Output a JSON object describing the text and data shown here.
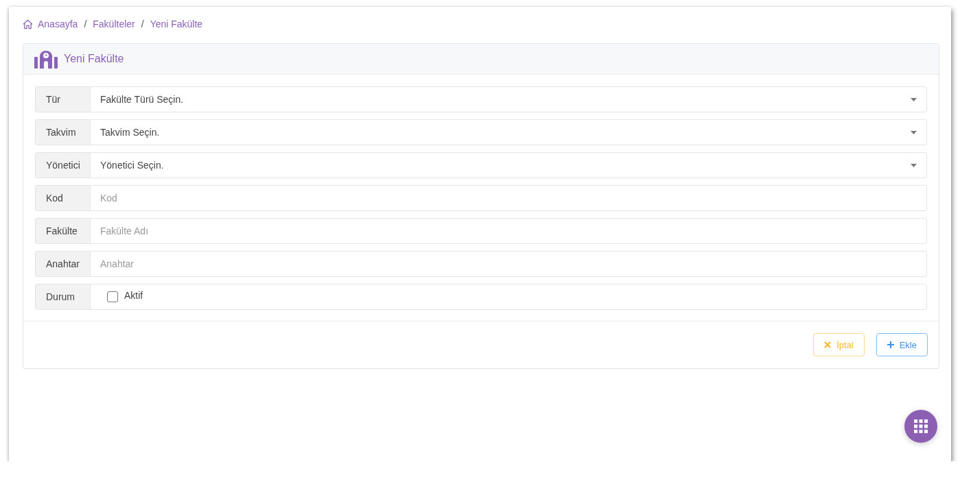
{
  "breadcrumb": {
    "items": [
      {
        "label": "Anasayfa"
      },
      {
        "label": "Fakülteler"
      },
      {
        "label": "Yeni Fakülte"
      }
    ],
    "separators": [
      "/",
      "/"
    ]
  },
  "card": {
    "title": "Yeni Fakülte"
  },
  "form_rows": [
    {
      "kind": "select",
      "label": "Tür",
      "value": "Fakülte Türü Seçin."
    },
    {
      "kind": "select",
      "label": "Takvim",
      "value": "Takvim Seçin."
    },
    {
      "kind": "select",
      "label": "Yönetici",
      "value": "Yönetici Seçin."
    },
    {
      "kind": "text",
      "label": "Kod",
      "placeholder": "Kod"
    },
    {
      "kind": "text",
      "label": "Fakülte",
      "placeholder": "Fakülte Adı"
    },
    {
      "kind": "text",
      "label": "Anahtar",
      "placeholder": "Anahtar"
    },
    {
      "kind": "checkbox",
      "label": "Durum",
      "option": "Aktif",
      "checked": false
    }
  ],
  "buttons": [
    {
      "kind": "cancel",
      "label": "İptal"
    },
    {
      "kind": "add",
      "label": "Ekle"
    }
  ]
}
